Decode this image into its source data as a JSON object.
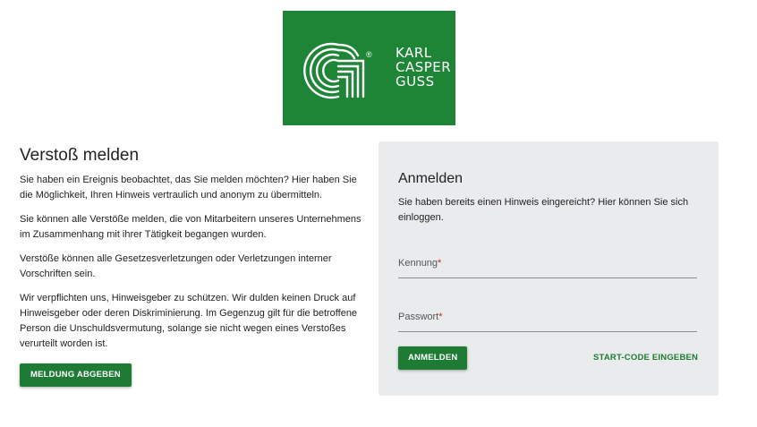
{
  "logo": {
    "line1": "KARL",
    "line2": "CASPER",
    "line3": "GUSS",
    "registered": "®",
    "bg_color": "#1e8537"
  },
  "report": {
    "title": "Verstoß melden",
    "paragraphs": [
      "Sie haben ein Ereignis beobachtet, das Sie melden möchten? Hier haben Sie die Möglichkeit, Ihren Hinweis vertraulich und anonym zu übermitteln.",
      "Sie können alle Verstöße melden, die von Mitarbeitern unseres Unternehmens im Zusammenhang mit ihrer Tätigkeit begangen wurden.",
      "Verstöße können alle Gesetzesverletzungen oder Verletzungen interner Vorschriften sein.",
      "Wir verpflichten uns, Hinweisgeber zu schützen. Wir dulden keinen Druck auf Hinweisgeber oder deren Diskriminierung. Im Gegenzug gilt für die betroffene Person die Unschuldsvermutung, solange sie nicht wegen eines Verstoßes verurteilt worden ist."
    ],
    "button_label": "Meldung abgeben"
  },
  "login": {
    "title": "Anmelden",
    "intro": "Sie haben bereits einen Hinweis eingereicht? Hier können Sie sich einloggen.",
    "fields": [
      {
        "label": "Kennung",
        "required_mark": "*",
        "value": ""
      },
      {
        "label": "Passwort",
        "required_mark": "*",
        "value": ""
      }
    ],
    "submit_label": "Anmelden",
    "startcode_label": "Start-Code eingeben"
  },
  "colors": {
    "accent": "#1e7b34",
    "card_bg": "#e9ebed",
    "required": "#c62828"
  }
}
